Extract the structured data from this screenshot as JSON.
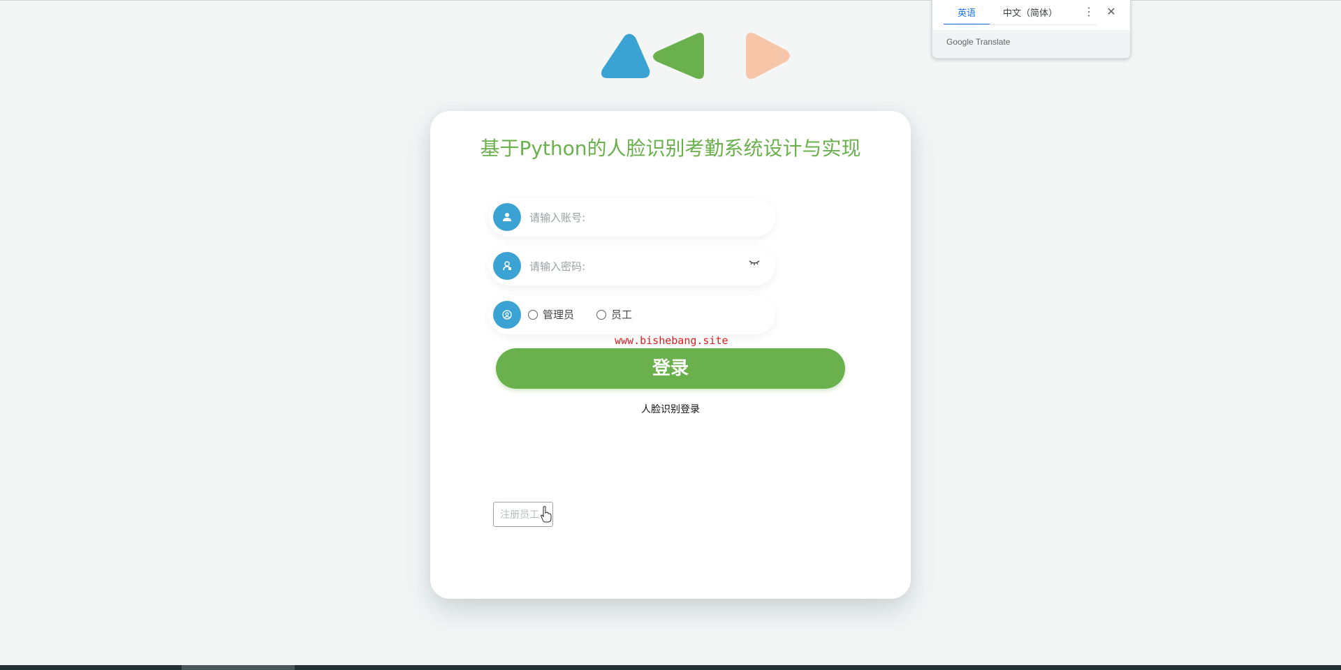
{
  "translate": {
    "tabs": [
      "英语",
      "中文（简体）"
    ],
    "more_icon": "more-vert-icon",
    "close_icon": "close-icon",
    "brand": "Google Translate"
  },
  "logo": {
    "colors": [
      "#3aa3d4",
      "#6ab04c",
      "#f7c6a8"
    ]
  },
  "login": {
    "title": "基于Python的人脸识别考勤系统设计与实现",
    "account_placeholder": "请输入账号:",
    "password_placeholder": "请输入密码:",
    "roles": [
      "管理员",
      "员工"
    ],
    "watermark": "www.bishebang.site",
    "login_label": "登录",
    "face_login_label": "人脸识别登录",
    "register_label": "注册员工"
  },
  "colors": {
    "accent_green": "#6ab04c",
    "accent_blue": "#3aa3d4",
    "watermark_red": "#d81f1f"
  }
}
